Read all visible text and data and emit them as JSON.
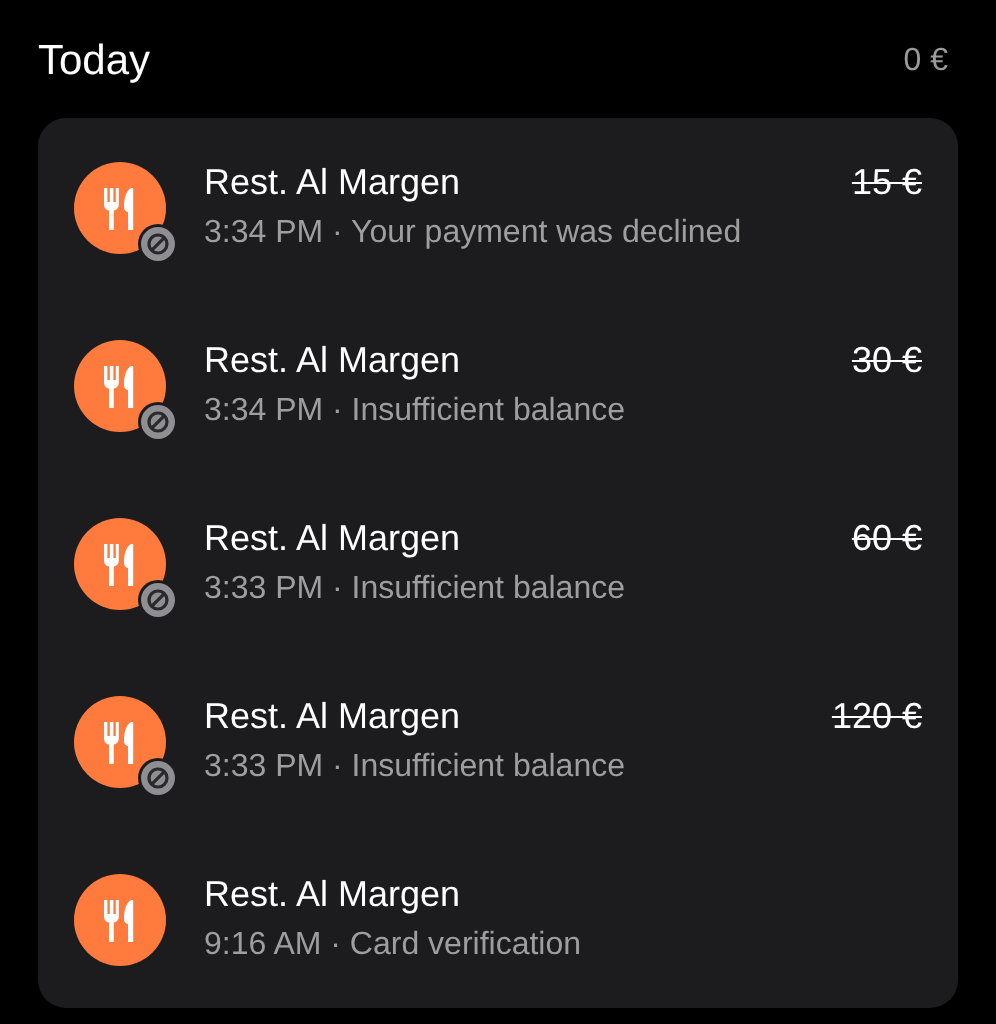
{
  "section": {
    "title": "Today",
    "total": "0 €"
  },
  "transactions": [
    {
      "merchant": "Rest. Al Margen",
      "detail": "3:34 PM · Your payment was declined",
      "amount": "15 €",
      "declined": true
    },
    {
      "merchant": "Rest. Al Margen",
      "detail": "3:34 PM · Insufficient balance",
      "amount": "30 €",
      "declined": true
    },
    {
      "merchant": "Rest. Al Margen",
      "detail": "3:33 PM · Insufficient balance",
      "amount": "60 €",
      "declined": true
    },
    {
      "merchant": "Rest. Al Margen",
      "detail": "3:33 PM · Insufficient balance",
      "amount": "120 €",
      "declined": true
    },
    {
      "merchant": "Rest. Al Margen",
      "detail": "9:16 AM · Card verification",
      "declined": false
    }
  ]
}
